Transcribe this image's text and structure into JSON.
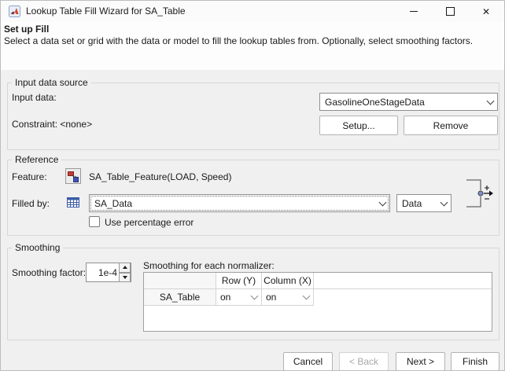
{
  "window": {
    "title": "Lookup Table Fill Wizard for SA_Table"
  },
  "header": {
    "title": "Set up Fill",
    "description": "Select a data set or grid with the data or model to fill the lookup tables from. Optionally, select smoothing factors."
  },
  "input_data_source": {
    "label": "Input data source",
    "input_data_label": "Input data:",
    "input_data_value": "GasolineOneStageData",
    "constraint_label": "Constraint: <none>",
    "setup_button": "Setup...",
    "remove_button": "Remove"
  },
  "reference": {
    "label": "Reference",
    "feature_label": "Feature:",
    "feature_value": "SA_Table_Feature(LOAD, Speed)",
    "filled_by_label": "Filled by:",
    "filled_by_value": "SA_Data",
    "fill_source_value": "Data",
    "use_percentage_error_label": "Use percentage error"
  },
  "smoothing": {
    "label": "Smoothing",
    "factor_label": "Smoothing factor:",
    "factor_value": "1e-4",
    "normalizer_label": "Smoothing for each normalizer:",
    "table": {
      "columns": [
        "",
        "Row (Y)",
        "Column (X)"
      ],
      "rows": [
        [
          "SA_Table",
          "on",
          "on"
        ]
      ]
    }
  },
  "footer": {
    "cancel_button": "Cancel",
    "back_button": "< Back",
    "next_button": "Next >",
    "finish_button": "Finish"
  },
  "colors": {
    "matlab_orange": "#d2452c",
    "icon_table_blue": "#3b5ba8",
    "icon_feature_red": "#c23b33",
    "icon_feature_blue": "#3f51b5",
    "dialog_background": "#f0f0f0"
  }
}
